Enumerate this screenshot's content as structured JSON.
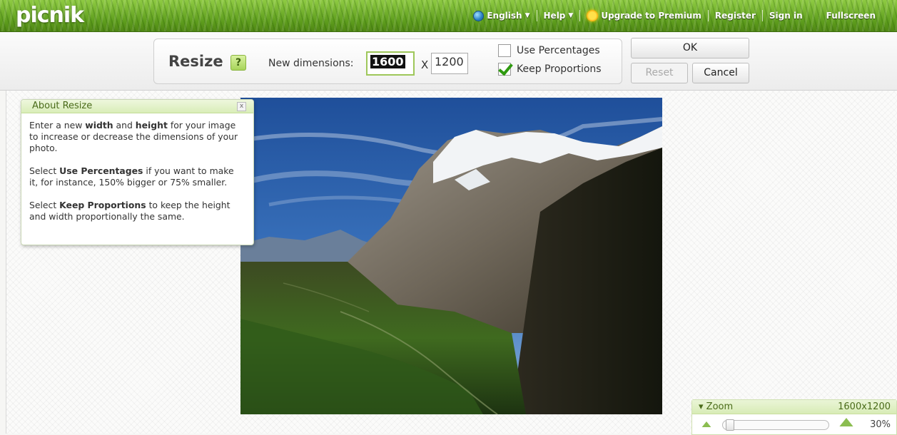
{
  "app": {
    "logo": "picnik"
  },
  "topnav": {
    "language": "English",
    "help": "Help",
    "upgrade": "Upgrade to Premium",
    "register": "Register",
    "signin": "Sign in",
    "fullscreen": "Fullscreen"
  },
  "tool": {
    "title": "Resize",
    "help_label": "?",
    "dimensions_label": "New dimensions:",
    "width_value": "1600",
    "x_label": "X",
    "height_value": "1200",
    "use_percentages_label": "Use Percentages",
    "use_percentages_checked": false,
    "keep_proportions_label": "Keep Proportions",
    "keep_proportions_checked": true,
    "ok_label": "OK",
    "reset_label": "Reset",
    "cancel_label": "Cancel"
  },
  "about": {
    "title": "About Resize",
    "close_label": "x",
    "p1": [
      "Enter a new ",
      "width",
      " and ",
      "height",
      " for your image to increase or decrease the dimensions of your photo."
    ],
    "p2": [
      "Select ",
      "Use Percentages",
      " if you want to make it, for instance, 150% bigger or 75% smaller."
    ],
    "p3": [
      "Select ",
      "Keep Proportions",
      " to keep the height and width proportionally the same."
    ]
  },
  "zoom": {
    "label": "Zoom",
    "image_size": "1600x1200",
    "percent": "30%",
    "level": 0.3
  },
  "colors": {
    "accent_green": "#5d9c1c",
    "panel_header": "#d9edb8",
    "check_green": "#2f9a10"
  }
}
